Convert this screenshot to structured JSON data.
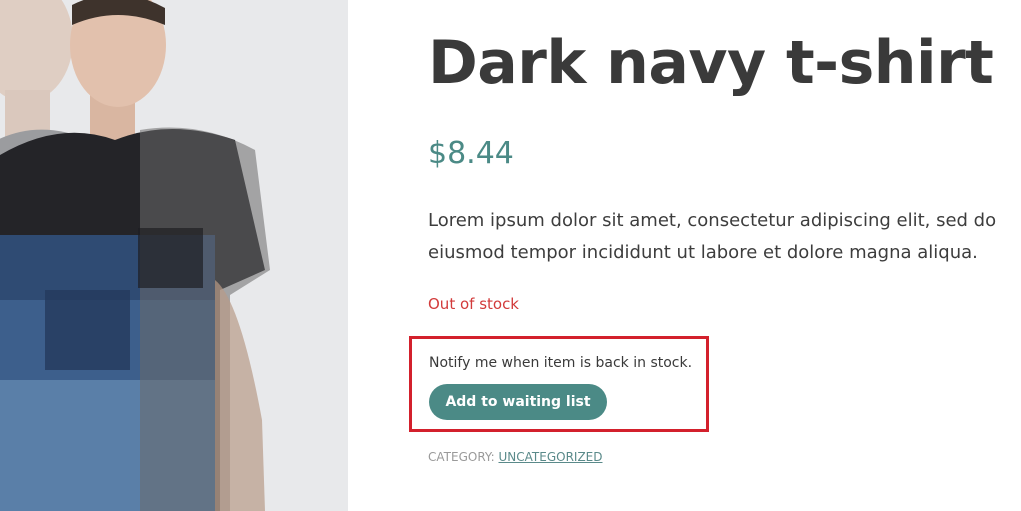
{
  "product": {
    "title": "Dark navy t-shirt",
    "price": "$8.44",
    "description": "Lorem ipsum dolor sit amet, consectetur adipiscing elit, sed do eiusmod tempor incididunt ut labore et dolore magna aliqua.",
    "stock_status": "Out of stock",
    "image_icon": "product-photo"
  },
  "waitlist": {
    "notify_text": "Notify me when item is back in stock.",
    "button_label": "Add to waiting list"
  },
  "category": {
    "label": "CATEGORY:",
    "value": "UNCATEGORIZED"
  },
  "colors": {
    "accent": "#4b8a86",
    "stock_red": "#d23a3a",
    "highlight_border": "#d3202c",
    "title": "#3a3a3a"
  }
}
